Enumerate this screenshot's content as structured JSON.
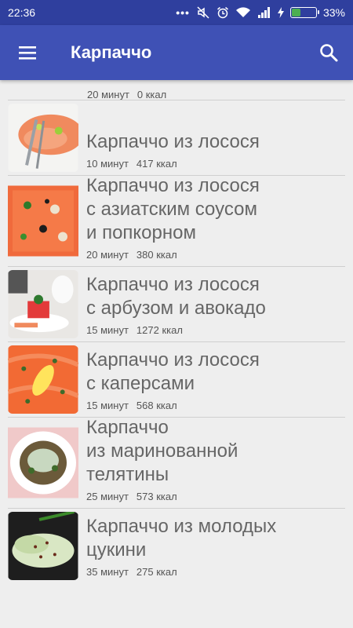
{
  "status": {
    "time": "22:36",
    "battery": "33%",
    "battery_level": 0.33,
    "icons": [
      "dots-icon",
      "mute-icon",
      "alarm-icon",
      "wifi-icon",
      "signal-icon",
      "charging-icon"
    ]
  },
  "appbar": {
    "title": "Карпаччо",
    "menu_icon": "hamburger-menu-icon",
    "search_icon": "search-icon"
  },
  "colors": {
    "appbar": "#3f51b5",
    "statusbar": "#2f3f9e",
    "text": "#666666"
  },
  "partial_item": {
    "time": "20 минут",
    "kcal": "0 ккал"
  },
  "recipes": [
    {
      "title": "Карпаччо из лосося",
      "time": "10 минут",
      "kcal": "417 ккал",
      "image": "salmon-carpaccio-photo"
    },
    {
      "title": "Карпаччо из лосося\nс азиатским соусом\nи попкорном",
      "time": "20 минут",
      "kcal": "380 ккал",
      "image": "salmon-asian-sauce-photo"
    },
    {
      "title": "Карпаччо из лосося\nс арбузом и авокадо",
      "time": "15 минут",
      "kcal": "1272 ккал",
      "image": "salmon-watermelon-photo"
    },
    {
      "title": "Карпаччо из лосося\nс каперсами",
      "time": "15 минут",
      "kcal": "568 ккал",
      "image": "salmon-capers-photo"
    },
    {
      "title": "Карпаччо\nиз маринованной\nтелятины",
      "time": "25 минут",
      "kcal": "573 ккал",
      "image": "marinated-veal-photo"
    },
    {
      "title": "Карпаччо из молодых\nцукини",
      "time": "35 минут",
      "kcal": "275 ккал",
      "image": "zucchini-carpaccio-photo"
    }
  ]
}
